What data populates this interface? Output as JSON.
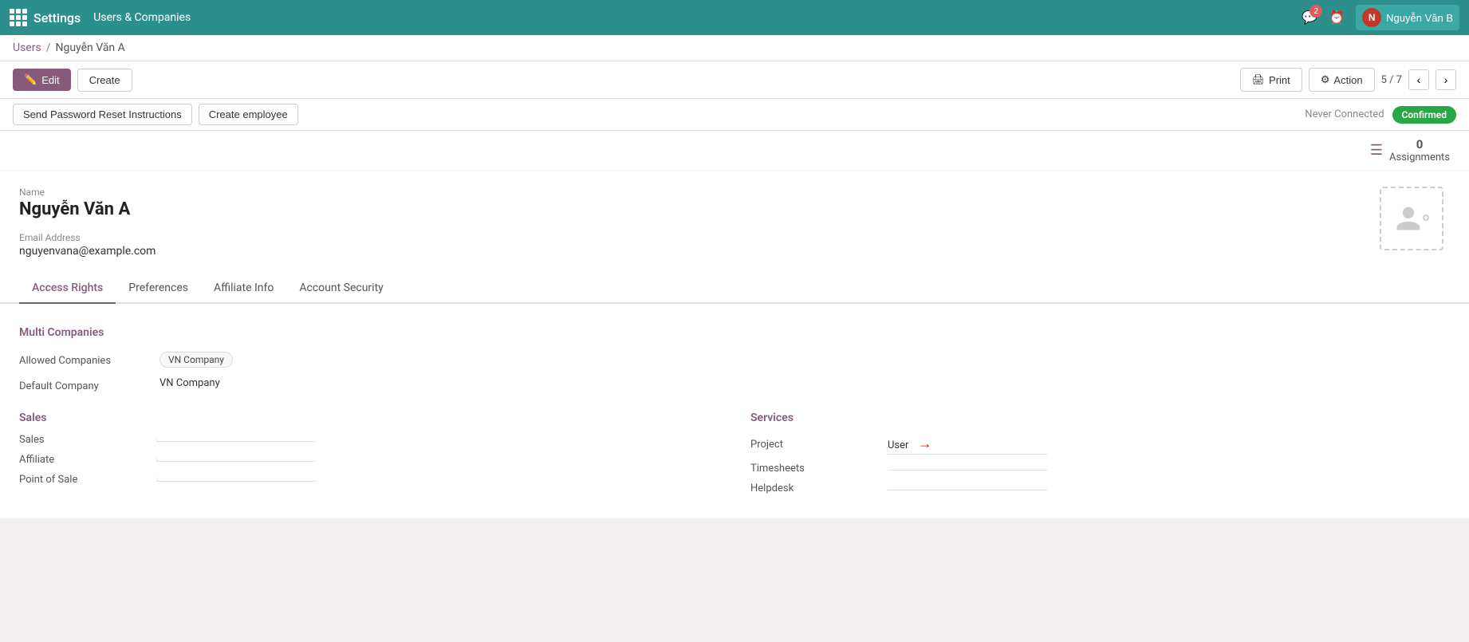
{
  "app": {
    "name": "Settings",
    "module": "Users & Companies"
  },
  "navbar": {
    "notification_count": "2",
    "user_name": "Nguyễn Văn B",
    "user_initial": "N"
  },
  "breadcrumb": {
    "parent": "Users",
    "current": "Nguyễn Văn A"
  },
  "toolbar": {
    "edit_label": "Edit",
    "create_label": "Create",
    "print_label": "Print",
    "action_label": "Action",
    "pager": "5 / 7"
  },
  "action_bar": {
    "send_reset_label": "Send Password Reset Instructions",
    "create_employee_label": "Create employee",
    "never_connected": "Never Connected",
    "status": "Confirmed"
  },
  "assignments": {
    "count": "0",
    "label": "Assignments"
  },
  "profile": {
    "name_label": "Name",
    "name_value": "Nguyễn Văn A",
    "email_label": "Email Address",
    "email_value": "nguyenvana@example.com"
  },
  "tabs": [
    {
      "id": "access_rights",
      "label": "Access Rights",
      "active": true
    },
    {
      "id": "preferences",
      "label": "Preferences",
      "active": false
    },
    {
      "id": "affiliate_info",
      "label": "Affiliate Info",
      "active": false
    },
    {
      "id": "account_security",
      "label": "Account Security",
      "active": false
    }
  ],
  "access_rights": {
    "multi_companies_header": "Multi Companies",
    "allowed_label": "Allowed Companies",
    "allowed_value": "VN Company",
    "default_label": "Default Company",
    "default_value": "VN Company",
    "sales_header": "Sales",
    "sales_rows": [
      {
        "label": "Sales",
        "value": ""
      },
      {
        "label": "Affiliate",
        "value": ""
      },
      {
        "label": "Point of Sale",
        "value": ""
      }
    ],
    "services_header": "Services",
    "services_rows": [
      {
        "label": "Project",
        "value": "User"
      },
      {
        "label": "Timesheets",
        "value": ""
      },
      {
        "label": "Helpdesk",
        "value": ""
      }
    ]
  }
}
